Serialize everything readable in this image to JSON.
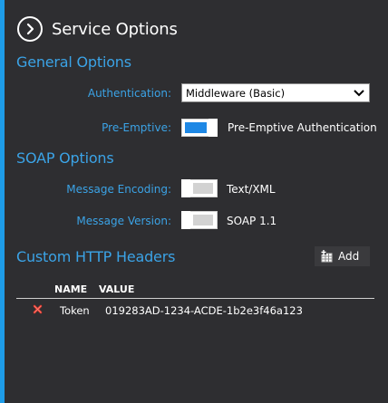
{
  "colors": {
    "accent": "#1e9ce8",
    "label": "#3ba3e6",
    "background": "#2e2e31",
    "toggle_on": "#1e88e5"
  },
  "header": {
    "title": "Service Options",
    "back_icon": "chevron-right-circle-icon"
  },
  "general": {
    "title": "General Options",
    "authentication_label": "Authentication:",
    "authentication_value": "Middleware (Basic)",
    "preemptive_label": "Pre-Emptive:",
    "preemptive_on": true,
    "preemptive_text": "Pre-Emptive Authentication"
  },
  "soap": {
    "title": "SOAP Options",
    "encoding_label": "Message Encoding:",
    "encoding_on": false,
    "encoding_text": "Text/XML",
    "version_label": "Message Version:",
    "version_on": false,
    "version_text": "SOAP 1.1"
  },
  "headers": {
    "title": "Custom HTTP Headers",
    "add_label": "Add",
    "add_icon": "add-table-icon",
    "columns": [
      "NAME",
      "VALUE"
    ],
    "rows": [
      {
        "name": "Token",
        "value": "019283AD-1234-ACDE-1b2e3f46a123",
        "delete_icon": "red-x-icon"
      }
    ]
  }
}
